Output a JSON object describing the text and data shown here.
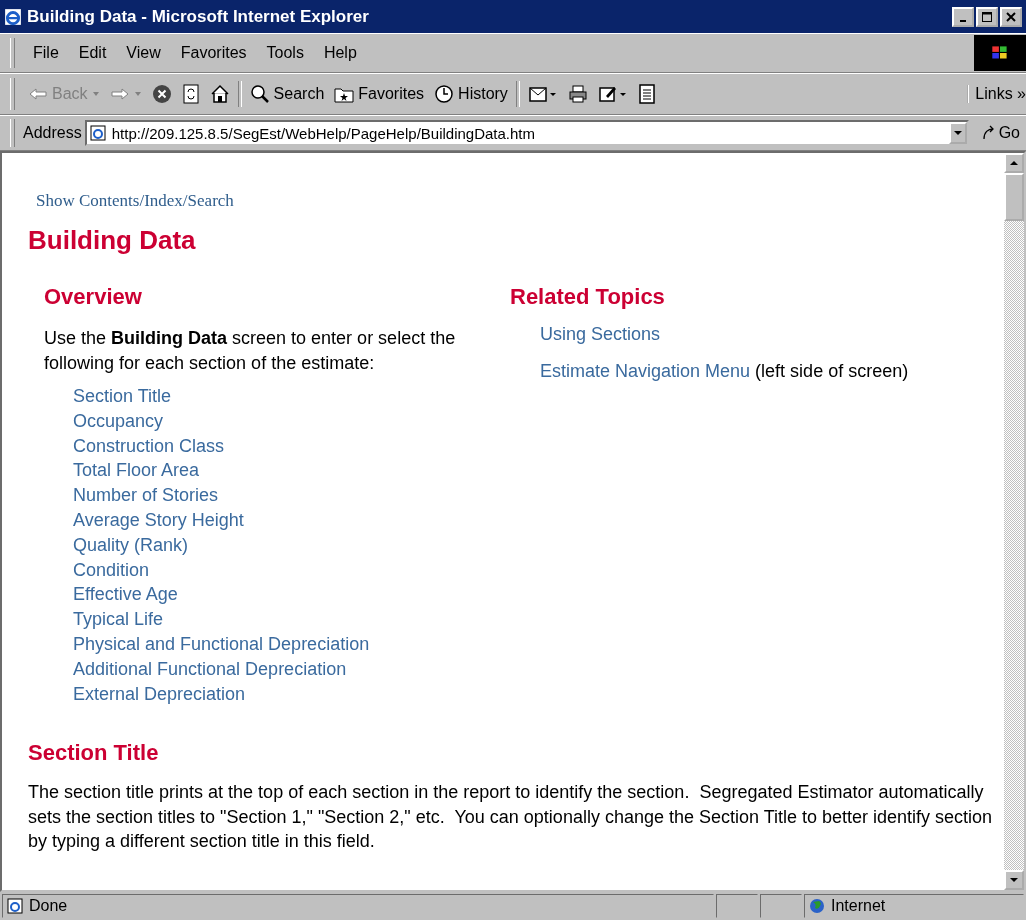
{
  "window": {
    "title": "Building Data - Microsoft Internet Explorer"
  },
  "menu": [
    "File",
    "Edit",
    "View",
    "Favorites",
    "Tools",
    "Help"
  ],
  "toolbar": [
    {
      "kind": "back",
      "label": "Back",
      "disabled": true
    },
    {
      "kind": "forward",
      "disabled": true
    },
    {
      "kind": "stop"
    },
    {
      "kind": "refresh"
    },
    {
      "kind": "home"
    },
    {
      "kind": "search",
      "label": "Search"
    },
    {
      "kind": "favorites",
      "label": "Favorites"
    },
    {
      "kind": "history",
      "label": "History"
    },
    {
      "kind": "mail"
    },
    {
      "kind": "print"
    },
    {
      "kind": "edit"
    },
    {
      "kind": "discuss"
    }
  ],
  "links_label": "Links »",
  "address": {
    "label": "Address",
    "value": "http://209.125.8.5/SegEst/WebHelp/PageHelp/BuildingData.htm",
    "go": "Go"
  },
  "page": {
    "show_contents": "Show Contents/Index/Search",
    "title": "Building Data",
    "overview": {
      "heading": "Overview",
      "text": "Use the **Building Data** screen to enter or select the following for each section of the estimate:",
      "links": [
        "Section Title",
        "Occupancy",
        "Construction Class",
        "Total Floor Area",
        "Number of Stories",
        "Average Story Height",
        "Quality (Rank)",
        "Condition",
        "Effective Age",
        "Typical Life",
        "Physical and Functional Depreciation",
        "Additional Functional Depreciation",
        "External Depreciation"
      ]
    },
    "related": {
      "heading": "Related Topics",
      "items": [
        {
          "link": "Using Sections"
        },
        {
          "link": "Estimate Navigation Menu",
          "note": "(left side of screen)"
        }
      ]
    },
    "section_title": {
      "heading": "Section Title",
      "text": "The section title prints at the top of each section in the report to identify the section.  Segregated Estimator automatically sets the section titles to \"Section 1,\" \"Section 2,\" etc.  You can optionally change the Section Title to better identify section by typing a different section title in this field."
    }
  },
  "status_bar": {
    "text": "Done",
    "zone": "Internet"
  }
}
